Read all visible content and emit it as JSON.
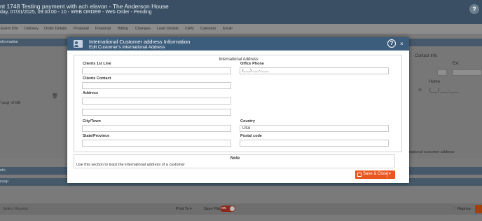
{
  "app": {
    "title_line1": "nt 1748 Testing payment with ach elavon - The Anderson House",
    "title_line2": "day, 07/31/2025, 09:30:00 - 10 - WEB ORDER - Web Order - Pending",
    "help": "?"
  },
  "menu": {
    "items": [
      "Event Info",
      "Delivery",
      "Order Details",
      "Proposal",
      "Financial",
      "Billing",
      "Changes",
      "Lead Details",
      "CRM",
      "Calendar",
      "Email"
    ]
  },
  "background": {
    "info_bar": "nformation",
    "file_note": "*.png) <5 MB",
    "contact_info": "Contact Info",
    "ext": "Ext",
    "home": "Home",
    "home_phone": "(___) ___-____",
    "intl_address": "rnational customer address",
    "bar2": "nfo",
    "bar3": "nsap"
  },
  "footer": {
    "select_reports": "Select Reports",
    "print_to": "Print To",
    "save_file": "Save File",
    "toggle": "ON",
    "reprice": "Reprice"
  },
  "modal": {
    "title": "International Customer address Information",
    "subtitle": "Edit Customer's International Address",
    "help": "?",
    "close": "×",
    "section_title": "International Address",
    "fields": {
      "clients_1st_line": {
        "label": "Clients 1st Line",
        "value": ""
      },
      "clients_contact": {
        "label": "Clients Contact",
        "value": ""
      },
      "address": {
        "label": "Address",
        "value": ""
      },
      "address2": {
        "value": ""
      },
      "city": {
        "label": "City/Town",
        "value": ""
      },
      "state": {
        "label": "State/Province",
        "value": ""
      },
      "office_phone": {
        "label": "Office Phone",
        "value": "(___) ___-____"
      },
      "country": {
        "label": "Country",
        "value": "USA"
      },
      "postal_code": {
        "label": "Postal code",
        "value": ""
      }
    },
    "note_title": "Note",
    "note_body": "Use this section to track the international address of a customer",
    "save_close": "Save & Close"
  }
}
